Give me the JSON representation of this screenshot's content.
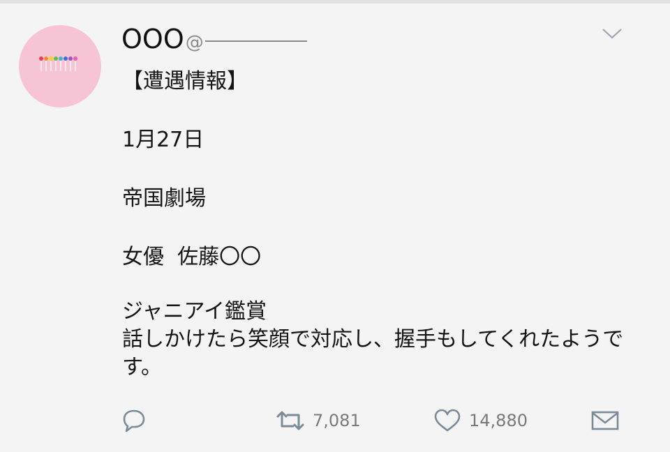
{
  "tweet": {
    "display_name": "OOO",
    "handle_prefix": "@",
    "text": {
      "line1": "【遭遇情報】",
      "line2": "1月27日",
      "line3": "帝国劇場",
      "line4": "女優  佐藤〇〇",
      "line5": "ジャニアイ鑑賞\n話しかけたら笑顔で対応し、握手もしてくれたようです。"
    }
  },
  "actions": {
    "retweet_count": "7,081",
    "like_count": "14,880"
  },
  "icons": {
    "menu": "chevron-down-icon",
    "reply": "reply-icon",
    "retweet": "retweet-icon",
    "like": "heart-icon",
    "dm": "mail-icon"
  },
  "colors": {
    "background": "#f4f4f4",
    "avatar": "#f7c4d5",
    "icon_gray": "#7a8a99"
  }
}
